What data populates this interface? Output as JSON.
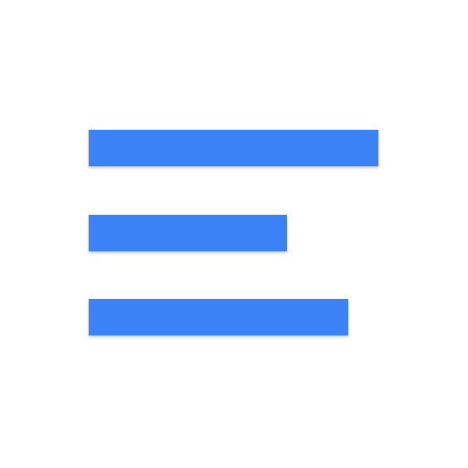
{
  "icon": {
    "name": "text-align-left-icon",
    "color": "#3b82f6",
    "background": "#ffffff",
    "lines": [
      {
        "id": "line-1"
      },
      {
        "id": "line-2"
      },
      {
        "id": "line-3"
      }
    ]
  }
}
